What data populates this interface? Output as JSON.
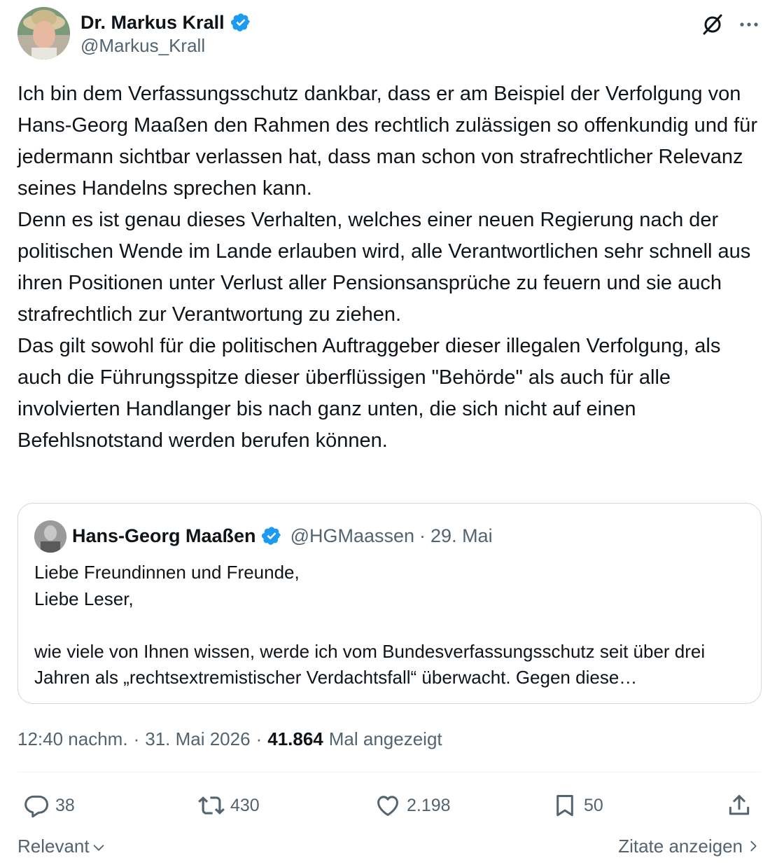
{
  "author": {
    "name": "Dr. Markus Krall",
    "handle": "@Markus_Krall",
    "verified": true
  },
  "tweet": {
    "text": "Ich bin dem Verfassungsschutz dankbar, dass er am Beispiel der Verfolgung von Hans-Georg Maaßen den Rahmen des rechtlich zulässigen so offenkundig und für jedermann sichtbar verlassen hat, dass man schon von strafrechtlicher Relevanz seines Handelns sprechen kann.\nDenn es ist genau dieses Verhalten, welches einer neuen Regierung nach der politischen Wende im Lande erlauben wird, alle Verantwortlichen sehr schnell aus ihren Positionen unter Verlust aller Pensionsansprüche zu feuern und sie auch strafrechtlich zur Verantwortung zu ziehen.\nDas gilt sowohl für die politischen Auftraggeber dieser illegalen Verfolgung, als auch die Führungsspitze dieser überflüssigen \"Behörde\" als auch für alle involvierten Handlanger bis nach ganz unten, die sich nicht auf einen Befehlsnotstand werden berufen können."
  },
  "quote": {
    "name": "Hans-Georg Maaßen",
    "handle": "@HGMaassen",
    "separator": "·",
    "date": "29. Mai",
    "text": "Liebe Freundinnen und Freunde,\nLiebe Leser,\n\nwie viele von Ihnen wissen, werde ich vom Bundesverfassungsschutz seit über drei Jahren als „rechtsextremistischer Verdachtsfall“ überwacht. Gegen diese…"
  },
  "meta": {
    "time": "12:40 nachm.",
    "separator": "·",
    "date": "31. Mai 2026",
    "views_count": "41.864",
    "views_label": "Mal angezeigt"
  },
  "actions": {
    "replies": "38",
    "reposts": "430",
    "likes": "2.198",
    "bookmarks": "50"
  },
  "footer": {
    "sort_label": "Relevant",
    "quotes_label": "Zitate anzeigen"
  },
  "colors": {
    "text": "#0f1419",
    "secondary": "#536471",
    "verified": "#1d9bf0",
    "border": "#cfd9de"
  },
  "icons": [
    "verified-badge-icon",
    "grok-icon",
    "more-icon",
    "reply-icon",
    "repost-icon",
    "like-icon",
    "bookmark-icon",
    "share-icon",
    "chevron-down-icon",
    "chevron-right-icon"
  ]
}
